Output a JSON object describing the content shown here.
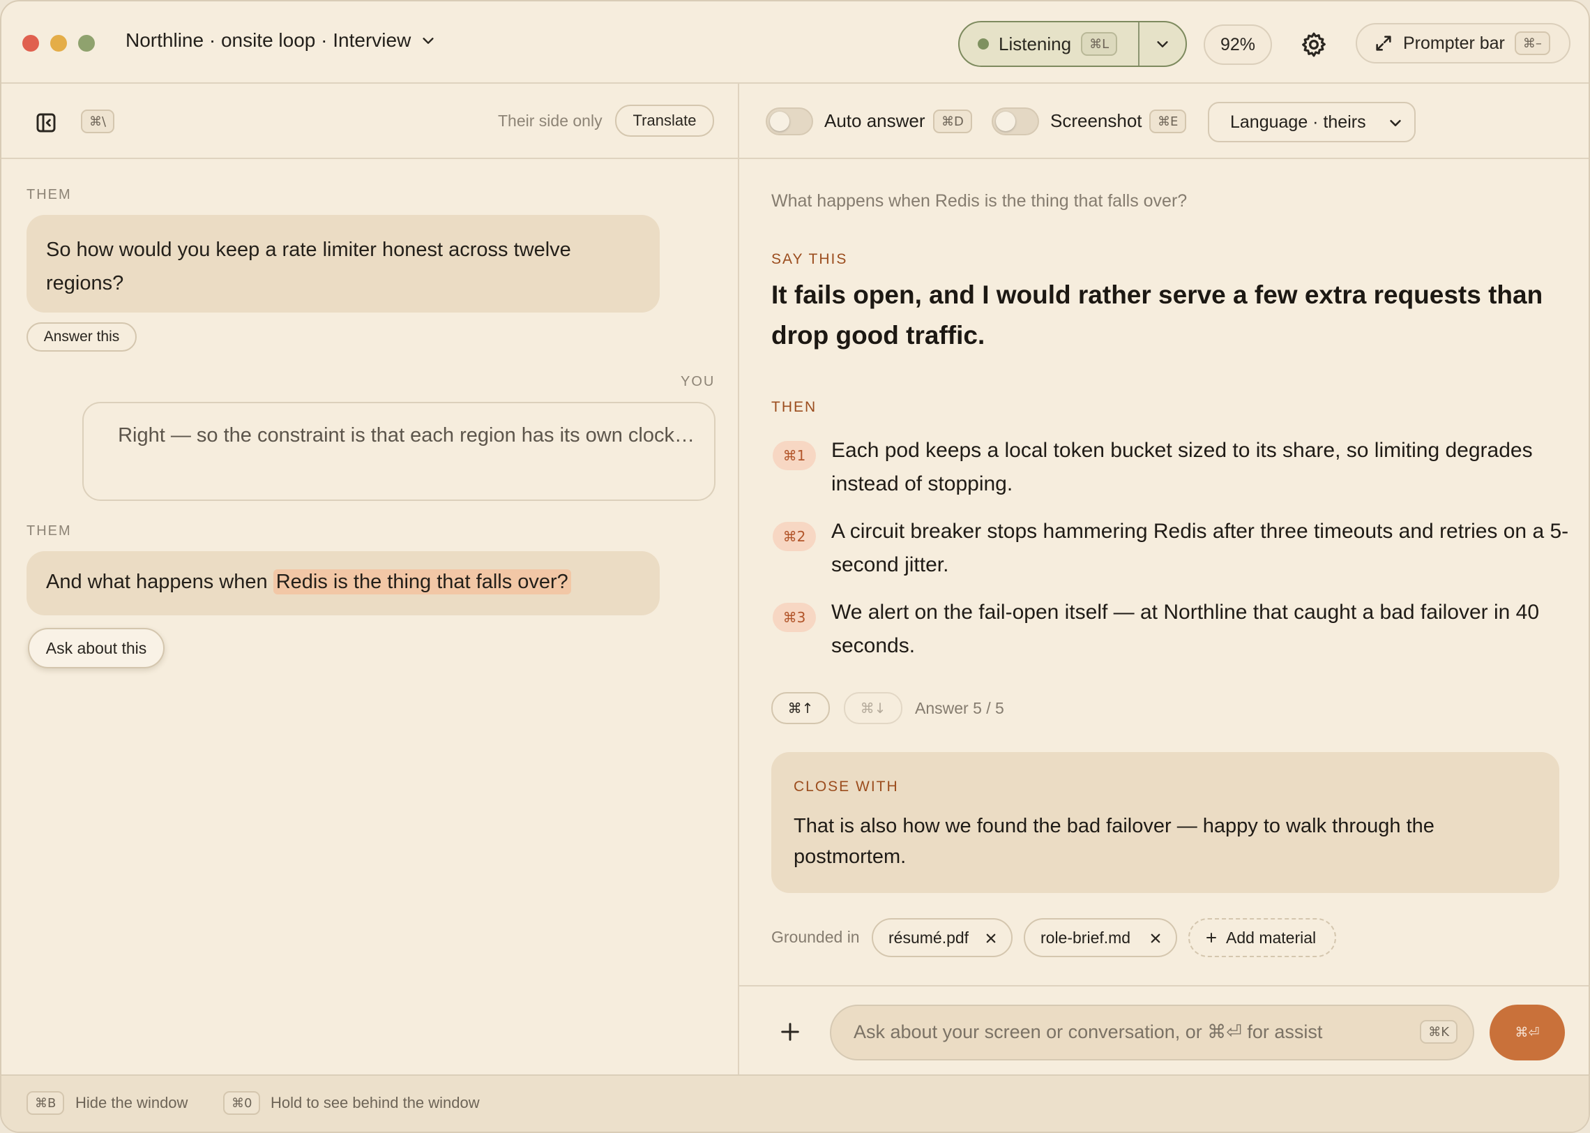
{
  "window": {
    "title": "Northline · onsite loop · Interview",
    "listening": {
      "label": "Listening",
      "shortcut": "⌘L"
    },
    "zoom": "92%",
    "prompter": {
      "label": "Prompter bar",
      "shortcut": "⌘–"
    }
  },
  "left": {
    "toolbar": {
      "sidebar_shortcut": "⌘\\",
      "their_side": "Their side only",
      "translate": "Translate"
    },
    "messages": [
      {
        "speaker": "THEM",
        "text": "So how would you keep a rate limiter honest across twelve regions?",
        "action": "Answer this"
      },
      {
        "speaker": "YOU",
        "text": "Right — so the constraint is that each region has its own clock…"
      },
      {
        "speaker": "THEM",
        "text_before": "And what happens when",
        "text_highlight": "Redis is the thing that falls over?",
        "action": "Ask about this"
      }
    ]
  },
  "right": {
    "toolbar": {
      "auto_answer": {
        "label": "Auto answer",
        "shortcut": "⌘D",
        "on": false
      },
      "screenshot": {
        "label": "Screenshot",
        "shortcut": "⌘E",
        "on": false
      },
      "language": "Language · theirs"
    },
    "question": "What happens when Redis is the thing that falls over?",
    "say_label": "SAY THIS",
    "say_text": "It fails open, and I would rather serve a few extra requests than drop good traffic.",
    "then_label": "THEN",
    "steps": [
      {
        "key": "⌘1",
        "text": "Each pod keeps a local token bucket sized to its share, so limiting degrades instead of stopping."
      },
      {
        "key": "⌘2",
        "text": "A circuit breaker stops hammering Redis after three timeouts and retries on a 5-second jitter."
      },
      {
        "key": "⌘3",
        "text": "We alert on the fail-open itself — at Northline that caught a bad failover in 40 seconds."
      }
    ],
    "nav": {
      "prev": "⌘↑",
      "next": "⌘↓",
      "counter": "Answer 5 / 5"
    },
    "close": {
      "label": "CLOSE WITH",
      "text": "That is also how we found the bad failover — happy to walk through the postmortem."
    },
    "grounded": {
      "label": "Grounded in",
      "files": [
        "résumé.pdf",
        "role-brief.md"
      ],
      "add": "Add material"
    },
    "composer": {
      "placeholder": "Ask about your screen or conversation, or ⌘⏎ for assist",
      "shortcut": "⌘K",
      "send": "⌘⏎"
    }
  },
  "footer": [
    {
      "key": "⌘B",
      "label": "Hide the window"
    },
    {
      "key": "⌘0",
      "label": "Hold to see behind the window"
    }
  ],
  "colors": {
    "accent": "#c9713a",
    "background": "#f6eddd",
    "bubble": "#ebdcc4",
    "listening": "#7f9160"
  }
}
